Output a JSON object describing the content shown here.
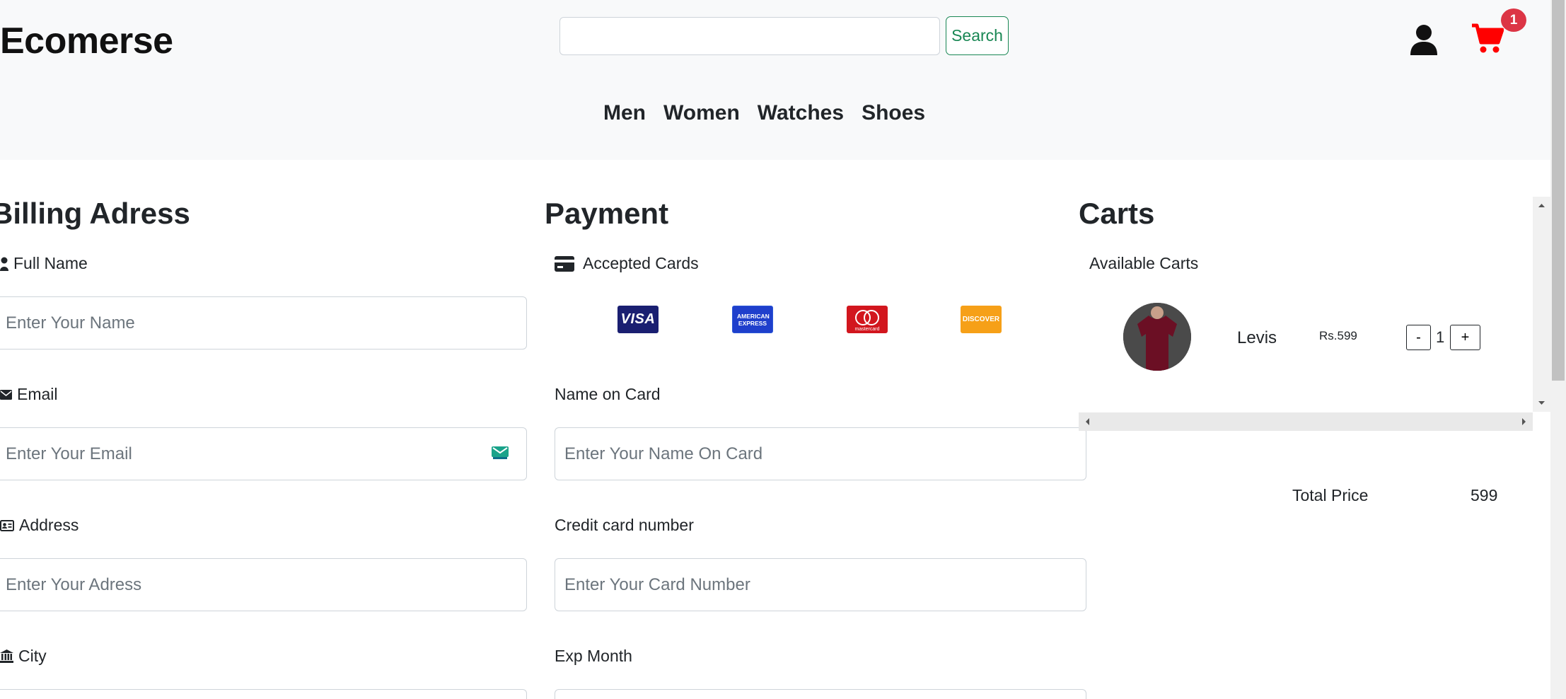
{
  "header": {
    "brand": "Ecomerse",
    "search": {
      "value": "",
      "placeholder": "",
      "button_label": "Search"
    },
    "cart_count": "1",
    "nav": [
      "Men",
      "Women",
      "Watches",
      "Shoes"
    ]
  },
  "billing": {
    "title": "Billing Adress",
    "full_name": {
      "label": "Full Name",
      "placeholder": "Enter Your Name"
    },
    "email": {
      "label": "Email",
      "placeholder": "Enter Your Email"
    },
    "address": {
      "label": "Address",
      "placeholder": "Enter Your Adress"
    },
    "city": {
      "label": "City"
    }
  },
  "payment": {
    "title": "Payment",
    "accepted_label": "Accepted Cards",
    "cards": [
      "VISA",
      "AMERICAN EXPRESS",
      "mastercard",
      "DISCOVER"
    ],
    "name_on_card": {
      "label": "Name on Card",
      "placeholder": "Enter Your Name On Card"
    },
    "card_number": {
      "label": "Credit card number",
      "placeholder": "Enter Your Card Number"
    },
    "exp_month": {
      "label": "Exp Month"
    }
  },
  "carts": {
    "title": "Carts",
    "subtitle": "Available Carts",
    "items": [
      {
        "name": "Levis",
        "price": "Rs.599",
        "qty": "1",
        "minus": "-",
        "plus": "+"
      }
    ],
    "total_label": "Total Price",
    "total_value": "599"
  },
  "colors": {
    "accent_green": "#198754",
    "badge_red": "#dc3545",
    "cart_icon_red": "#ff0000",
    "header_bg": "#f8f9fa"
  }
}
